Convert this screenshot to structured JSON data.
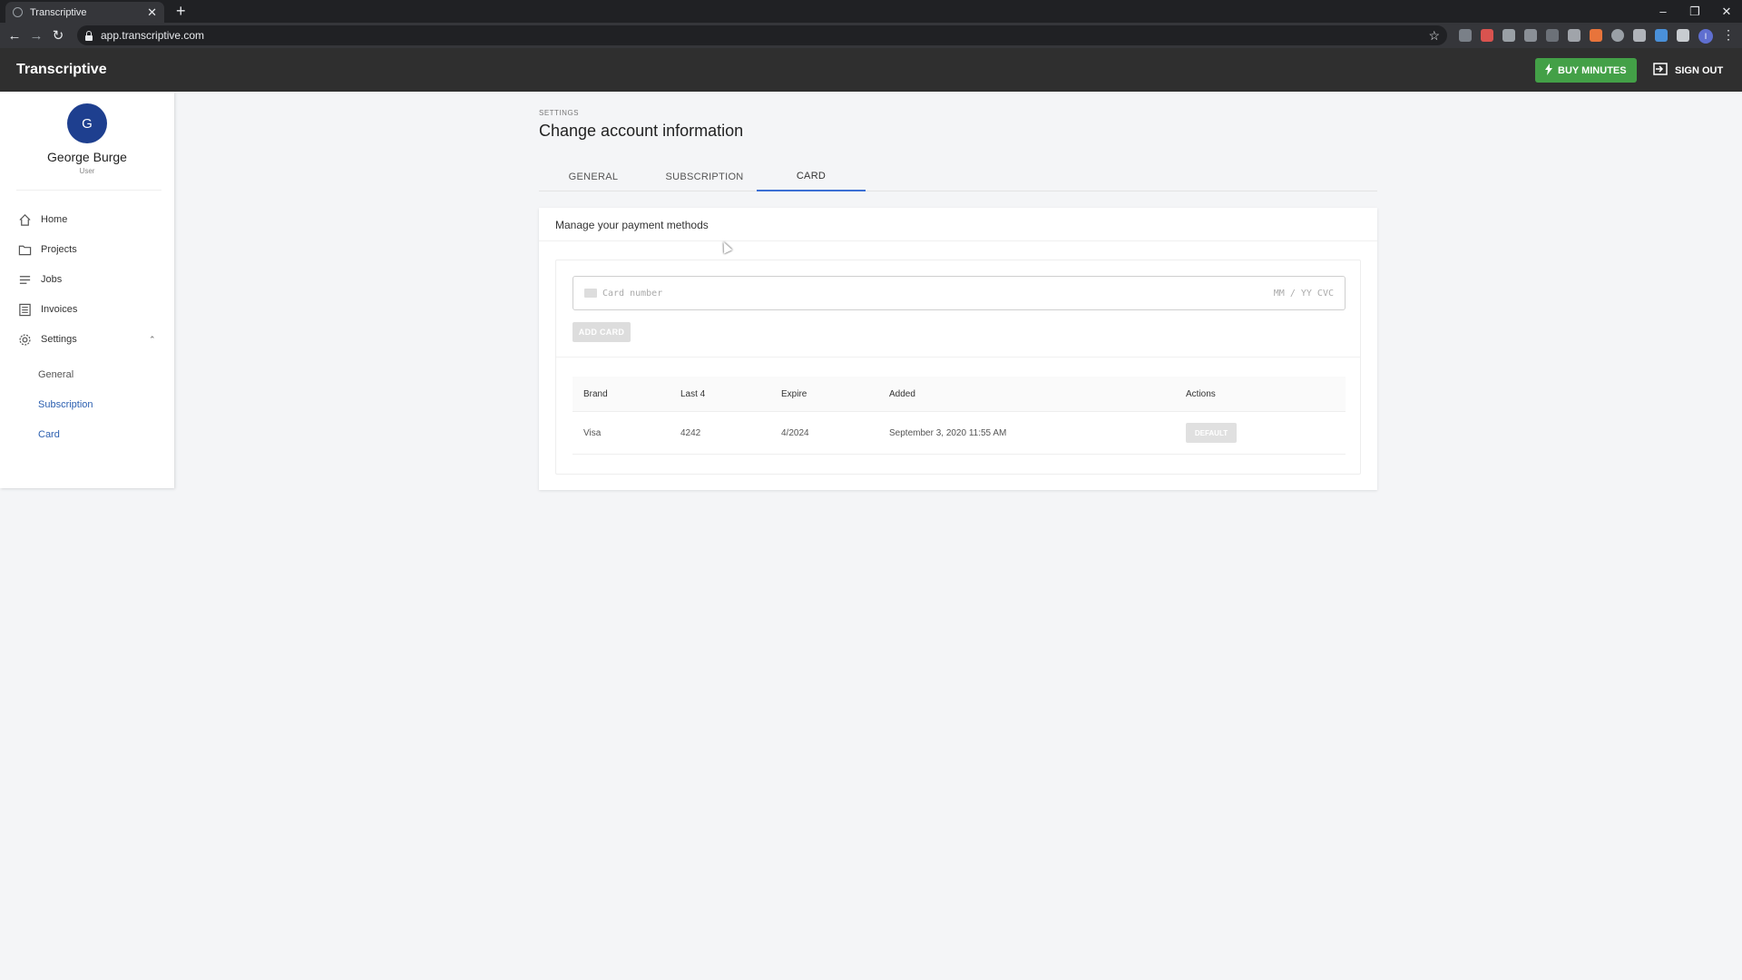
{
  "browser": {
    "tab_title": "Transcriptive",
    "tab_close": "✕",
    "new_tab": "+",
    "url": "app.transcriptive.com",
    "profile_initial": "I"
  },
  "app": {
    "brand": "Transcriptive",
    "buy_minutes": "BUY MINUTES",
    "sign_out": "SIGN OUT"
  },
  "user": {
    "initial": "G",
    "name": "George Burge",
    "role": "User"
  },
  "sidebar": {
    "items": [
      {
        "label": "Home",
        "icon": "home-icon"
      },
      {
        "label": "Projects",
        "icon": "folder-icon"
      },
      {
        "label": "Jobs",
        "icon": "list-icon"
      },
      {
        "label": "Invoices",
        "icon": "invoice-icon"
      },
      {
        "label": "Settings",
        "icon": "gear-icon"
      }
    ],
    "settings_sub": [
      "General",
      "Subscription",
      "Card"
    ]
  },
  "main": {
    "breadcrumb": "SETTINGS",
    "title": "Change account information",
    "tabs": [
      "GENERAL",
      "SUBSCRIPTION",
      "CARD"
    ],
    "active_tab": "CARD",
    "card_section": {
      "title": "Manage your payment methods",
      "card_number_placeholder": "Card number",
      "expiry_cvc_placeholder": "MM / YY CVC",
      "add_card": "ADD CARD",
      "columns": [
        "Brand",
        "Last 4",
        "Expire",
        "Added",
        "Actions"
      ],
      "rows": [
        {
          "brand": "Visa",
          "last4": "4242",
          "expire": "4/2024",
          "added": "September 3, 2020 11:55 AM",
          "action": "DEFAULT"
        }
      ]
    }
  },
  "colors": {
    "buy_button": "#43a047",
    "avatar": "#1e3f8f",
    "active_tab_underline": "#3b6fd4",
    "link": "#2b5fb0"
  }
}
